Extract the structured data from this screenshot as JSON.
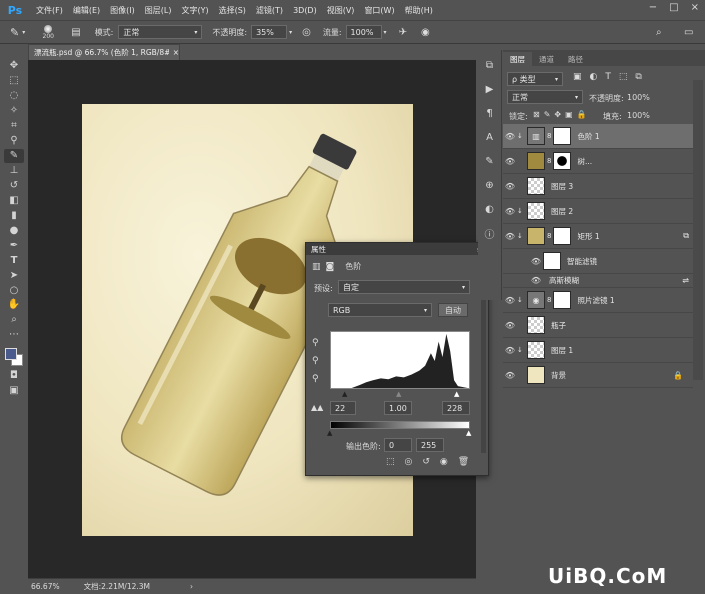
{
  "menu": {
    "logo": "Ps",
    "items": [
      "文件(F)",
      "编辑(E)",
      "图像(I)",
      "图层(L)",
      "文字(Y)",
      "选择(S)",
      "滤镜(T)",
      "3D(D)",
      "视图(V)",
      "窗口(W)",
      "帮助(H)"
    ],
    "window_controls": [
      "−",
      "□",
      "×"
    ]
  },
  "options": {
    "brush_size": "200",
    "mode_label": "模式:",
    "mode_value": "正常",
    "opacity_label": "不透明度:",
    "opacity_value": "35%",
    "flow_label": "流量:",
    "flow_value": "100%"
  },
  "document": {
    "tab_title": "漂流瓶.psd @ 66.7% (色阶 1, RGB/8#) *",
    "close": "×",
    "zoom": "66.67%",
    "doc_info": "文档:2.21M/12.3M",
    "status_arrow": "›"
  },
  "properties": {
    "title": "属性",
    "layer_name": "色阶",
    "preset_label": "预设:",
    "preset_value": "自定",
    "channel_value": "RGB",
    "auto_label": "自动",
    "input_black": "22",
    "input_gamma": "1.00",
    "input_white": "228",
    "output_label": "输出色阶:",
    "output_black": "0",
    "output_white": "255"
  },
  "layers_panel": {
    "tabs": [
      "图层",
      "通道",
      "路径"
    ],
    "filter_label": "ρ 类型",
    "blend_mode": "正常",
    "opacity_label": "不透明度:",
    "opacity_value": "100%",
    "lock_label": "锁定:",
    "fill_label": "填充:",
    "fill_value": "100%",
    "layers": [
      {
        "name": "色阶 1",
        "selected": true
      },
      {
        "name": "树..."
      },
      {
        "name": "图层 3"
      },
      {
        "name": "图层 2"
      },
      {
        "name": "矩形 1"
      },
      {
        "name": "智能滤镜"
      },
      {
        "name": "高斯模糊"
      },
      {
        "name": "照片滤镜 1"
      },
      {
        "name": "瓶子"
      },
      {
        "name": "图层 1"
      },
      {
        "name": "背景"
      }
    ]
  },
  "watermark": "UiBQ.CoM"
}
